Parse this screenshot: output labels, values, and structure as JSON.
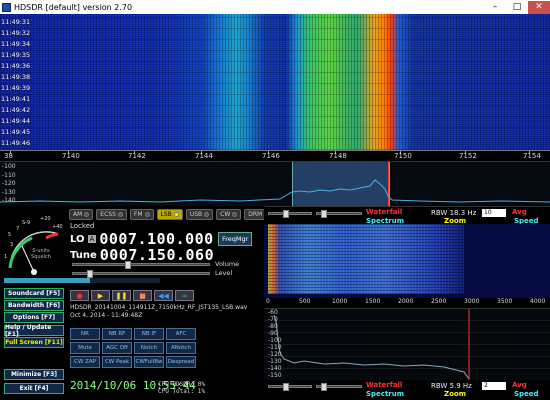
{
  "window": {
    "title": "HDSDR [default]  version 2.70",
    "min": "–",
    "max": "□",
    "close": "✕"
  },
  "waterfall": {
    "times": [
      "11:49:31",
      "11:49:32",
      "11:49:34",
      "11:49:35",
      "11:49:36",
      "11:49:38",
      "11:49:39",
      "11:49:41",
      "11:49:42",
      "11:49:44",
      "11:49:45",
      "11:49:46"
    ],
    "freq_labels": [
      "38",
      "7140",
      "7142",
      "7144",
      "7146",
      "7148",
      "7150",
      "7152",
      "7154"
    ]
  },
  "spectrum": {
    "db_labels": [
      "-100",
      "-110",
      "-120",
      "-130",
      "-140"
    ]
  },
  "modes": [
    {
      "label": "AM",
      "active": false
    },
    {
      "label": "ECSS",
      "active": false
    },
    {
      "label": "FM",
      "active": false
    },
    {
      "label": "LSB",
      "active": true
    },
    {
      "label": "USB",
      "active": false
    },
    {
      "label": "CW",
      "active": false
    },
    {
      "label": "DRM",
      "active": false
    }
  ],
  "tuning": {
    "locked_label": "Locked",
    "lo_label": "LO",
    "lo_badge": "A",
    "lo_value": "0007.100.000",
    "tune_label": "Tune",
    "tune_value": "0007.150.060",
    "freqmgr": "FreqMgr",
    "volume_label": "Volume",
    "level_label": "Level",
    "level_fraction": 0.55
  },
  "smeter": {
    "scale": [
      "+40",
      "+20",
      "S-9",
      "3",
      "1",
      "5",
      "7"
    ],
    "label": "S-units Squelch"
  },
  "sidebuttons": [
    {
      "label": "Soundcard  [F5]",
      "color": "white"
    },
    {
      "label": "Bandwidth  [F6]",
      "color": "white"
    },
    {
      "label": "Options  [F7]",
      "color": "white"
    },
    {
      "label": "Help / Update  [F1]",
      "color": "white"
    },
    {
      "label": "Full Screen  [F11]",
      "color": "yellow"
    },
    {
      "label": "Minimize  [F3]",
      "color": "white"
    },
    {
      "label": "Exit  [F4]",
      "color": "white"
    }
  ],
  "transport": {
    "record": "●",
    "play": "▶",
    "pause": "❚❚",
    "stop": "■",
    "rewind": "◀◀",
    "loop": "∞"
  },
  "file": {
    "name": "HDSDR_20141004_114911Z_7150kHz_RF_JST135_LSB.wav",
    "date": "Oct 4, 2014 - 11:49:48Z"
  },
  "function_buttons": [
    "NR",
    "NB RF",
    "NB IF",
    "AFC",
    "Mute",
    "AGC Off",
    "Notch",
    "ANotch",
    "CW ZAP",
    "CW Peak",
    "CWFullBw",
    "Despread"
  ],
  "status": {
    "clock": "2014/10/06 10:55:44",
    "cpu_hdsdr": "CPU HDSDR: 0%",
    "cpu_total": "CPU Total: 1%"
  },
  "right_top": {
    "waterfall": "Waterfall",
    "spectrum": "Spectrum",
    "rbw": "RBW 18.3 Hz",
    "avg_value": "10",
    "avg": "Avg",
    "zoom": "Zoom",
    "speed": "Speed"
  },
  "right_scale": [
    "0",
    "500",
    "1000",
    "1500",
    "2000",
    "2500",
    "3000",
    "3500",
    "4000"
  ],
  "right_spec": {
    "db_labels": [
      "-60",
      "-70",
      "-80",
      "-90",
      "-100",
      "-110",
      "-120",
      "-130",
      "-140",
      "-150"
    ]
  },
  "right_bottom": {
    "waterfall": "Waterfall",
    "spectrum": "Spectrum",
    "rbw": "RBW 5.9 Hz",
    "avg_value": "2",
    "avg": "Avg",
    "zoom": "Zoom",
    "speed": "Speed"
  }
}
